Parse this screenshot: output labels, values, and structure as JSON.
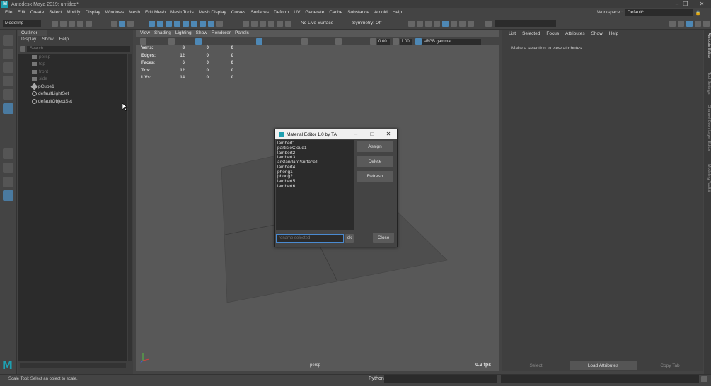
{
  "app": {
    "title": "Autodesk Maya 2019: untitled*",
    "logo": "M"
  },
  "menubar": [
    "File",
    "Edit",
    "Create",
    "Select",
    "Modify",
    "Display",
    "Windows",
    "Mesh",
    "Edit Mesh",
    "Mesh Tools",
    "Mesh Display",
    "Curves",
    "Surfaces",
    "Deform",
    "UV",
    "Generate",
    "Cache",
    "Substance",
    "Arnold",
    "Help"
  ],
  "workspace": {
    "label": "Workspace :",
    "value": "Default*"
  },
  "status_line": {
    "mode": "Modeling",
    "live_surface": "No Live Surface",
    "symmetry": "Symmetry: Off"
  },
  "outliner": {
    "tab": "Outliner",
    "menus": [
      "Display",
      "Show",
      "Help"
    ],
    "search_placeholder": "Search...",
    "items": [
      {
        "label": "persp",
        "dim": true,
        "icon": "camera-icon"
      },
      {
        "label": "top",
        "dim": true,
        "icon": "camera-icon"
      },
      {
        "label": "front",
        "dim": true,
        "icon": "camera-icon"
      },
      {
        "label": "side",
        "dim": true,
        "icon": "camera-icon"
      },
      {
        "label": "pCube1",
        "dim": false,
        "icon": "mesh-icon"
      },
      {
        "label": "defaultLightSet",
        "dim": false,
        "icon": "set-icon"
      },
      {
        "label": "defaultObjectSet",
        "dim": false,
        "icon": "set-icon"
      }
    ]
  },
  "viewport": {
    "menus": [
      "View",
      "Shading",
      "Lighting",
      "Show",
      "Renderer",
      "Panels"
    ],
    "exposure": "0.00",
    "gamma": "1.00",
    "color_space": "sRGB gamma",
    "camera": "persp",
    "fps": "0.2 fps",
    "hud": [
      {
        "label": "Verts:",
        "values": [
          "8",
          "0",
          "0"
        ]
      },
      {
        "label": "Edges:",
        "values": [
          "12",
          "0",
          "0"
        ]
      },
      {
        "label": "Faces:",
        "values": [
          "6",
          "0",
          "0"
        ]
      },
      {
        "label": "Tris:",
        "values": [
          "12",
          "0",
          "0"
        ]
      },
      {
        "label": "UVs:",
        "values": [
          "14",
          "0",
          "0"
        ]
      }
    ]
  },
  "attribute_editor": {
    "menus": [
      "List",
      "Selected",
      "Focus",
      "Attributes",
      "Show",
      "Help"
    ],
    "message": "Make a selection to view attributes",
    "buttons": [
      "Select",
      "Load Attributes",
      "Copy Tab"
    ]
  },
  "side_tabs": [
    "Attribute Editor",
    "Tool Settings",
    "Channel Box / Layer Editor",
    "Modeling Toolkit"
  ],
  "help_line": "Scale Tool: Select an object to scale.",
  "script_label": "Python",
  "dialog": {
    "title": "Material Editor 1.0 by TA",
    "materials": [
      "lambert1",
      "particleCloud1",
      "lambert2",
      "lambert3",
      "aiStandardSurface1",
      "lambert4",
      "phong1",
      "phong2",
      "lambert5",
      "lambert6"
    ],
    "buttons": {
      "assign": "Assign",
      "delete": "Delete",
      "refresh": "Refresh",
      "ok": "ok",
      "close": "Close"
    },
    "rename_placeholder": "rename selected"
  }
}
